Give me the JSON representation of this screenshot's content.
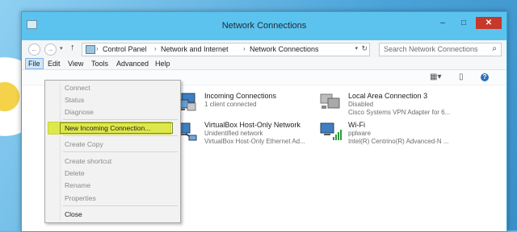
{
  "window": {
    "title": "Network Connections"
  },
  "titlebar_buttons": {
    "minimize": "–",
    "maximize": "□",
    "close": "✕"
  },
  "nav": {
    "back": "←",
    "forward": "→",
    "recent": "▾",
    "up": "↑"
  },
  "address": {
    "crumbs": [
      "Control Panel",
      "Network and Internet",
      "Network Connections"
    ],
    "separator": "›",
    "dropdown": "▾",
    "refresh": "↻"
  },
  "search": {
    "placeholder": "Search Network Connections",
    "icon": "⌕"
  },
  "menubar": [
    "File",
    "Edit",
    "View",
    "Tools",
    "Advanced",
    "Help"
  ],
  "toolbar": {
    "views": "▦▾",
    "preview": "▯",
    "help": "?"
  },
  "file_menu": {
    "items": [
      {
        "label": "Connect",
        "enabled": false
      },
      {
        "label": "Status",
        "enabled": false
      },
      {
        "label": "Diagnose",
        "enabled": false
      },
      {
        "label": "New Incoming Connection...",
        "enabled": true,
        "highlighted": true
      },
      {
        "label": "Create Copy",
        "enabled": false
      },
      {
        "label": "Create shortcut",
        "enabled": false
      },
      {
        "label": "Delete",
        "enabled": false
      },
      {
        "label": "Rename",
        "enabled": false
      },
      {
        "label": "Properties",
        "enabled": false
      },
      {
        "label": "Close",
        "enabled": true
      }
    ]
  },
  "connections": [
    {
      "name": "Incoming Connections",
      "line1": "1 client connected",
      "line2": "",
      "icon": "incoming-connections-icon"
    },
    {
      "name": "Local Area Connection 3",
      "line1": "Disabled",
      "line2": "Cisco Systems VPN Adapter for 6...",
      "icon": "ethernet-adapter-icon"
    },
    {
      "name": "VirtualBox Host-Only Network",
      "line1": "Unidentified network",
      "line2": "VirtualBox Host-Only Ethernet Ad...",
      "icon": "ethernet-adapter-icon"
    },
    {
      "name": "Wi-Fi",
      "line1": "pplware",
      "line2": "Intel(R) Centrino(R) Advanced-N ...",
      "icon": "wifi-adapter-icon"
    }
  ],
  "colors": {
    "titlebar": "#5bc3ee",
    "highlight": "#dfe84a",
    "close": "#c7372a"
  }
}
